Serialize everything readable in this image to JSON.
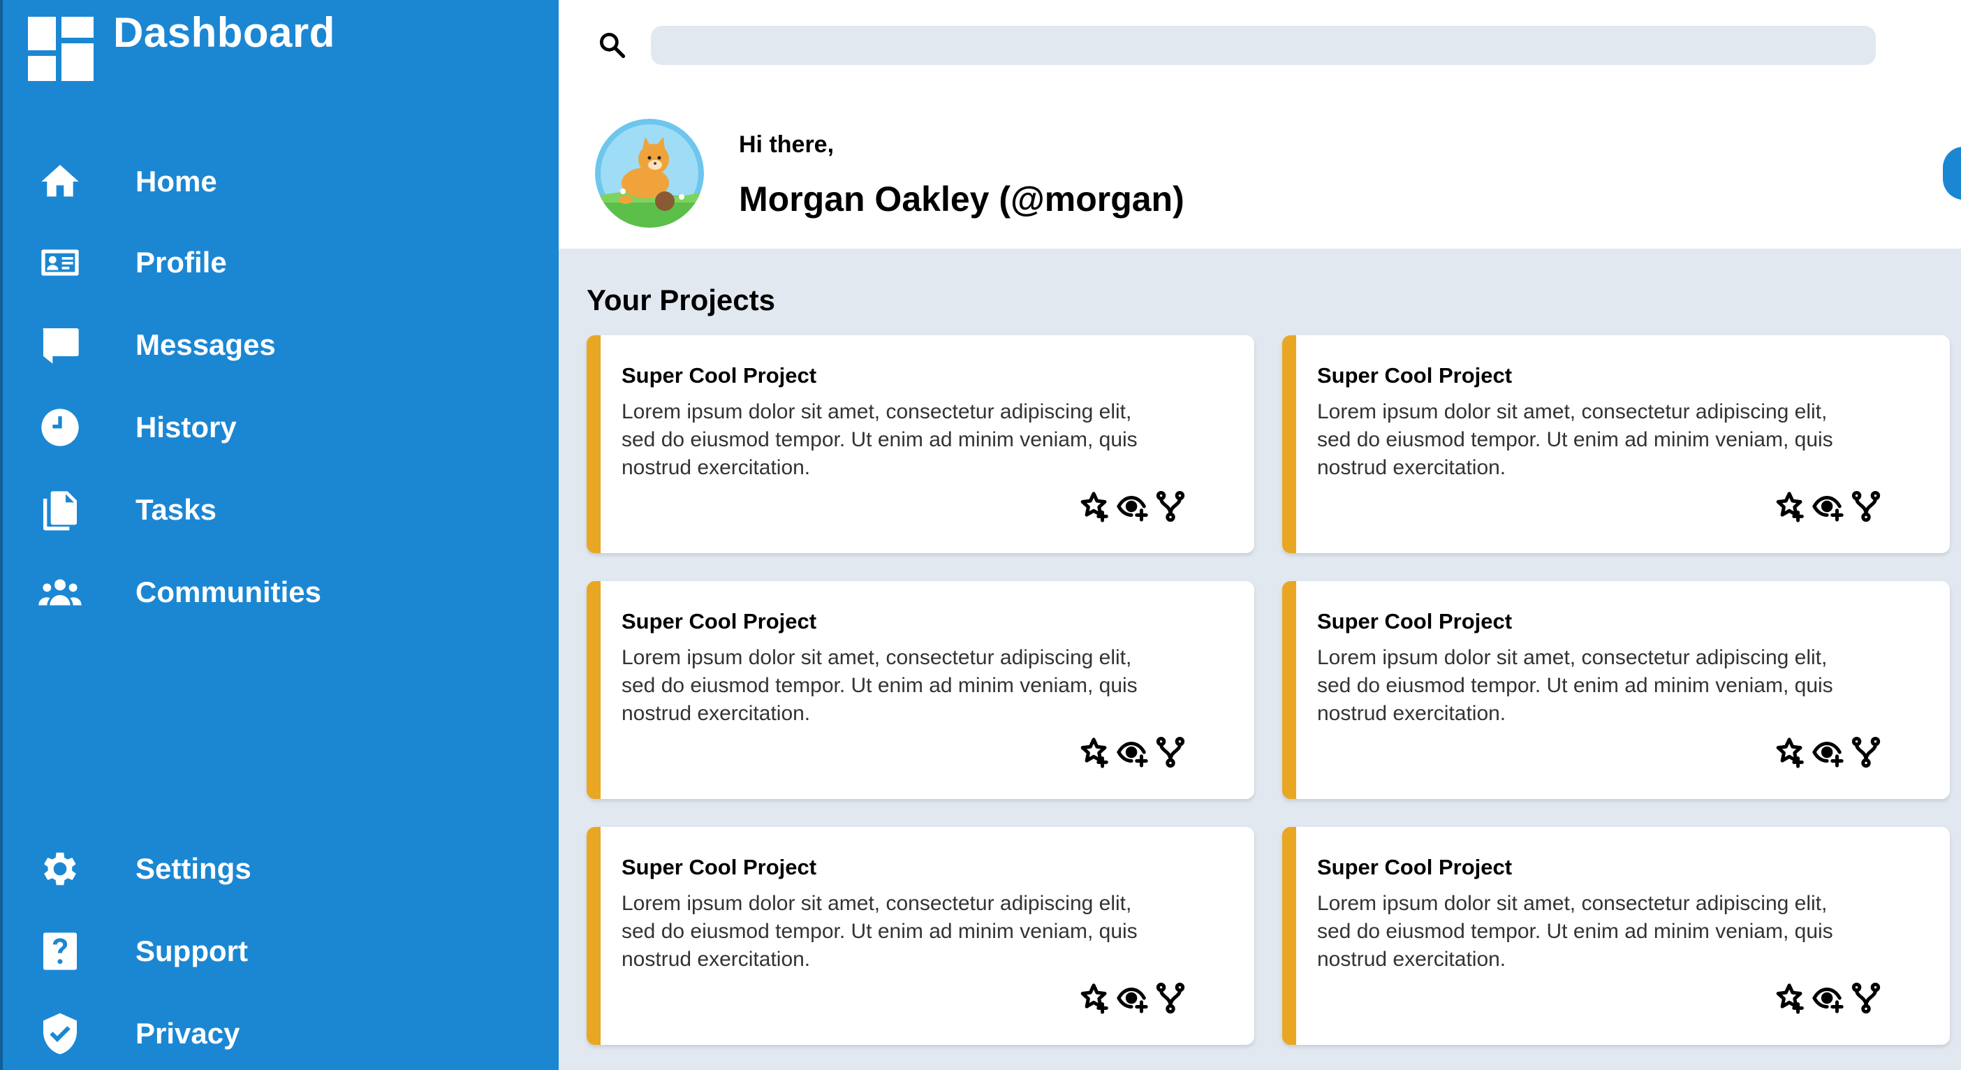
{
  "sidebar": {
    "brand_title": "Dashboard",
    "items": [
      {
        "label": "Home",
        "icon": "home-icon"
      },
      {
        "label": "Profile",
        "icon": "id-card-icon"
      },
      {
        "label": "Messages",
        "icon": "message-icon"
      },
      {
        "label": "History",
        "icon": "clock-icon"
      },
      {
        "label": "Tasks",
        "icon": "documents-icon"
      },
      {
        "label": "Communities",
        "icon": "people-icon"
      }
    ],
    "bottom_items": [
      {
        "label": "Settings",
        "icon": "gear-icon"
      },
      {
        "label": "Support",
        "icon": "help-icon"
      },
      {
        "label": "Privacy",
        "icon": "shield-icon"
      }
    ]
  },
  "header": {
    "search_placeholder": "",
    "search_value": "",
    "greeting": "Hi there,",
    "user_name": "Morgan Oakley (@morgan)"
  },
  "main": {
    "section_title": "Your Projects",
    "projects": [
      {
        "title": "Super Cool Project",
        "description": "Lorem ipsum dolor sit amet, consectetur adipiscing elit, sed do eiusmod tempor. Ut enim ad minim veniam, quis nostrud exercitation."
      },
      {
        "title": "Super Cool Project",
        "description": "Lorem ipsum dolor sit amet, consectetur adipiscing elit, sed do eiusmod tempor. Ut enim ad minim veniam, quis nostrud exercitation."
      },
      {
        "title": "Super Cool Project",
        "description": "Lorem ipsum dolor sit amet, consectetur adipiscing elit, sed do eiusmod tempor. Ut enim ad minim veniam, quis nostrud exercitation."
      },
      {
        "title": "Super Cool Project",
        "description": "Lorem ipsum dolor sit amet, consectetur adipiscing elit, sed do eiusmod tempor. Ut enim ad minim veniam, quis nostrud exercitation."
      },
      {
        "title": "Super Cool Project",
        "description": "Lorem ipsum dolor sit amet, consectetur adipiscing elit, sed do eiusmod tempor. Ut enim ad minim veniam, quis nostrud exercitation."
      },
      {
        "title": "Super Cool Project",
        "description": "Lorem ipsum dolor sit amet, consectetur adipiscing elit, sed do eiusmod tempor. Ut enim ad minim veniam, quis nostrud exercitation."
      }
    ],
    "card_actions": [
      "star-add-icon",
      "watch-add-icon",
      "fork-icon"
    ]
  },
  "colors": {
    "sidebar": "#1b87d3",
    "accent": "#e9a623",
    "background": "#e2e8f0",
    "surface": "#ffffff"
  }
}
